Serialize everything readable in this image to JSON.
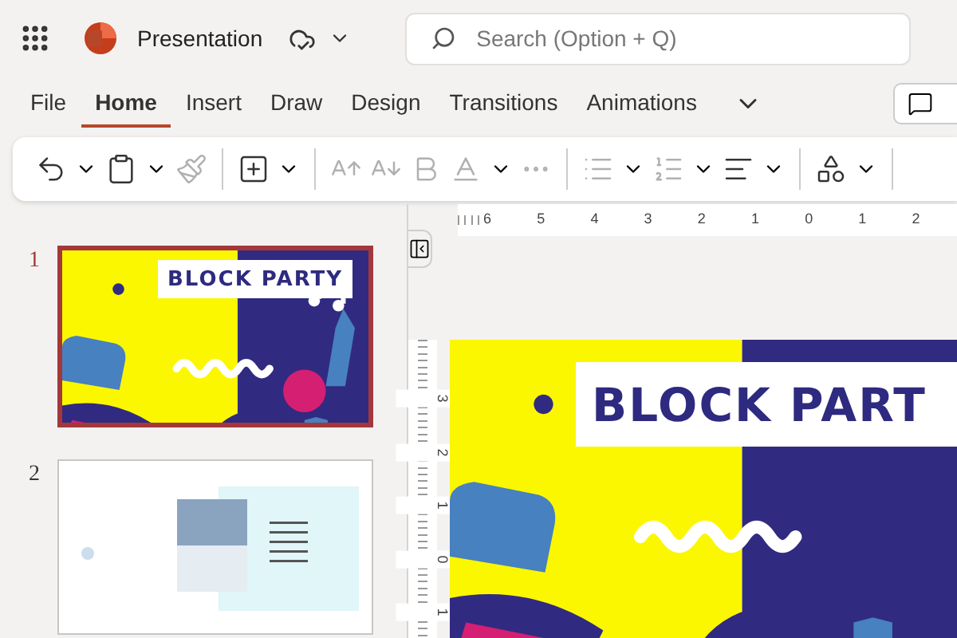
{
  "app": {
    "title": "Presentation"
  },
  "search": {
    "placeholder": "Search (Option + Q)"
  },
  "tabs": [
    {
      "label": "File",
      "selected": false
    },
    {
      "label": "Home",
      "selected": true
    },
    {
      "label": "Insert",
      "selected": false
    },
    {
      "label": "Draw",
      "selected": false
    },
    {
      "label": "Design",
      "selected": false
    },
    {
      "label": "Transitions",
      "selected": false
    },
    {
      "label": "Animations",
      "selected": false
    }
  ],
  "slides": [
    {
      "number": "1",
      "selected": true,
      "kind": "party",
      "title": "BLOCK PARTY"
    },
    {
      "number": "2",
      "selected": false,
      "kind": "agenda"
    }
  ],
  "ruler": {
    "horizontal": [
      "6",
      "5",
      "4",
      "3",
      "2",
      "1",
      "0",
      "1",
      "2"
    ],
    "vertical": [
      "3",
      "2",
      "1",
      "0",
      "1"
    ]
  },
  "canvas": {
    "title": "BLOCK PART"
  }
}
